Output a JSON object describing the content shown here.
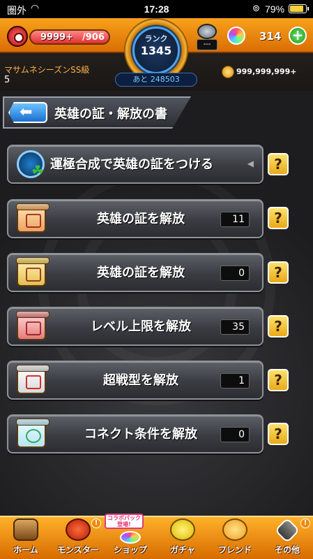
{
  "status_bar": {
    "carrier": "圏外",
    "time": "17:28",
    "battery_percent": "79%",
    "battery_level": 0.79,
    "icons": [
      "wifi-icon",
      "rotation-lock-icon",
      "battery-charging-icon"
    ]
  },
  "header": {
    "stamina_value": "9999+",
    "stamina_max": "/906",
    "stamina_fill": 1.0,
    "rank_label": "ランク",
    "rank_value": "1345",
    "bomb_box": "---",
    "orb_count": "314",
    "rank_title": "マサムネシーズンSS級",
    "rank_title_num": "5",
    "next_exp": "あと 248503",
    "gold": "999,999,999+"
  },
  "page": {
    "title": "英雄の証・解放の書"
  },
  "menu": [
    {
      "label": "運極合成で英雄の証をつける",
      "count": null,
      "icon": "shield-clover-icon",
      "help": "?"
    },
    {
      "label": "英雄の証を解放",
      "count": "11",
      "icon": "scroll-red-icon",
      "help": "?"
    },
    {
      "label": "英雄の証を解放",
      "count": "0",
      "icon": "scroll-gold-icon",
      "help": "?"
    },
    {
      "label": "レベル上限を解放",
      "count": "35",
      "icon": "scroll-pink-icon",
      "help": "?"
    },
    {
      "label": "超戦型を解放",
      "count": "1",
      "icon": "scroll-white-icon",
      "help": "?"
    },
    {
      "label": "コネクト条件を解放",
      "count": "0",
      "icon": "scroll-teal-icon",
      "help": "?"
    }
  ],
  "nav": {
    "home": "ホーム",
    "monster": "モンスター",
    "shop": "ショップ",
    "shop_banner": "コラボパック登場!",
    "gacha": "ガチャ",
    "friend": "フレンド",
    "other": "その他",
    "badge": "!"
  },
  "colors": {
    "accent_orange": "#f8a21a",
    "help_yellow": "#ffe169",
    "row_gray": "#3a3c42",
    "back_blue": "#1a6fd0"
  }
}
